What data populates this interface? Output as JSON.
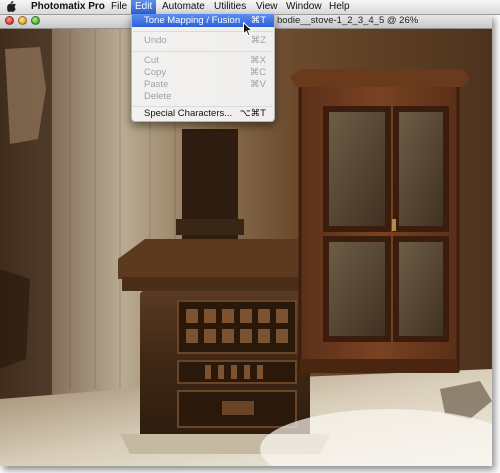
{
  "menubar": {
    "apple_icon": "apple-icon",
    "app_name": "Photomatix Pro",
    "items": [
      {
        "label": "File"
      },
      {
        "label": "Edit"
      },
      {
        "label": "Automate"
      },
      {
        "label": "Utilities"
      },
      {
        "label": "View"
      },
      {
        "label": "Window"
      },
      {
        "label": "Help"
      }
    ],
    "active_item": "Edit"
  },
  "window": {
    "title": "bodie__stove-1_2_3_4_5 @ 26%",
    "document_icon": "document-icon"
  },
  "edit_menu": {
    "items": [
      {
        "label": "Tone Mapping / Fusion",
        "shortcut": "⌘T",
        "state": "highlighted"
      },
      {
        "label": "Undo",
        "shortcut": "⌘Z",
        "state": "disabled"
      },
      {
        "label": "Cut",
        "shortcut": "⌘X",
        "state": "disabled"
      },
      {
        "label": "Copy",
        "shortcut": "⌘C",
        "state": "disabled"
      },
      {
        "label": "Paste",
        "shortcut": "⌘V",
        "state": "disabled"
      },
      {
        "label": "Delete",
        "shortcut": "",
        "state": "disabled"
      },
      {
        "label": "Special Characters...",
        "shortcut": "⌥⌘T",
        "state": "enabled"
      }
    ]
  },
  "colors": {
    "menu_highlight": "#3a6fe0",
    "disabled_text": "#a2a2a2"
  },
  "image": {
    "description_icon": "photo-canvas"
  }
}
